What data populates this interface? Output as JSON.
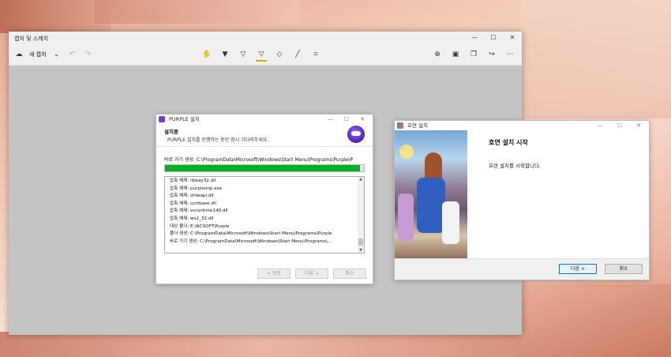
{
  "snip": {
    "title": "캡처 및 스케치",
    "new_capture_label": "새 캡처",
    "window_controls": [
      "—",
      "☐",
      "✕"
    ],
    "toolbar": {
      "left_icons": [
        "new-capture-icon",
        "chevron-down-icon",
        "undo-icon",
        "redo-icon"
      ],
      "center_tools": [
        "touch-writing-icon",
        "ballpoint-pen-icon",
        "pencil-icon",
        "highlighter-icon",
        "eraser-icon",
        "ruler-icon",
        "crop-icon"
      ],
      "right_tools": [
        "zoom-icon",
        "save-icon",
        "copy-icon",
        "share-icon",
        "more-icon"
      ]
    }
  },
  "purple_installer": {
    "title": "PURPLE 설치",
    "header_title": "설치중",
    "header_sub": "PURPLE 설치를 진행하는 동안 잠시 기다려주세요.",
    "current_action": "바로 가기 생성: C:\\ProgramData\\Microsoft\\Windows\\Start Menu\\Programs\\Purple\\P",
    "progress": 0.98,
    "progress_color": "#06b025",
    "log": [
      "압축 해제: libeay32.dll",
      "압축 해제: purpleonp.exe",
      "압축 해제: shlwapi.dll",
      "압축 해제: ucrtbase.dll",
      "압축 해제: vcruntime140.dll",
      "압축 해제: ws2_32.dll",
      "대상 폴더: E:\\NCSOFT\\Purple",
      "폴더 생성: C:\\ProgramData\\Microsoft\\Windows\\Start Menu\\Programs\\Purple",
      "바로 가기 생성: C:\\ProgramData\\Microsoft\\Windows\\Start Menu\\Programs\\..."
    ],
    "buttons": {
      "back": "< 뒤로",
      "next": "다음 >",
      "cancel": "취소"
    }
  },
  "setup": {
    "title": "호연 설치",
    "heading": "호연 설치 시작",
    "description": "호연 설치를 시작합니다.",
    "buttons": {
      "next": "다음 >",
      "cancel": "취소"
    }
  }
}
